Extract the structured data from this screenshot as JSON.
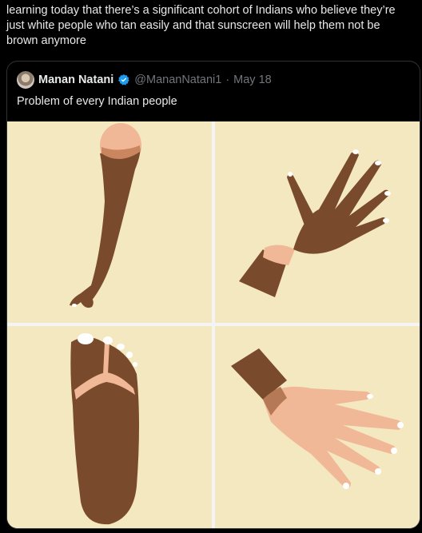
{
  "tweet": {
    "text": "learning today that there’s a significant cohort of Indians who believe they’re just white people who tan easily and that sunscreen will help them not be brown anymore"
  },
  "quote": {
    "author_name": "Manan Natani",
    "handle": "@MananNatani1",
    "separator": "·",
    "date": "May 18",
    "text": "Problem of every Indian people"
  },
  "colors": {
    "background": "#000000",
    "text": "#e7e9ea",
    "muted": "#71767b",
    "verified": "#1d9bf0",
    "panel_bg": "#f4e8c0",
    "skin_dark": "#7a4a2c",
    "skin_light": "#f0b896"
  },
  "icons": {
    "verified": "verified-badge-icon",
    "avatar": "profile-avatar"
  }
}
